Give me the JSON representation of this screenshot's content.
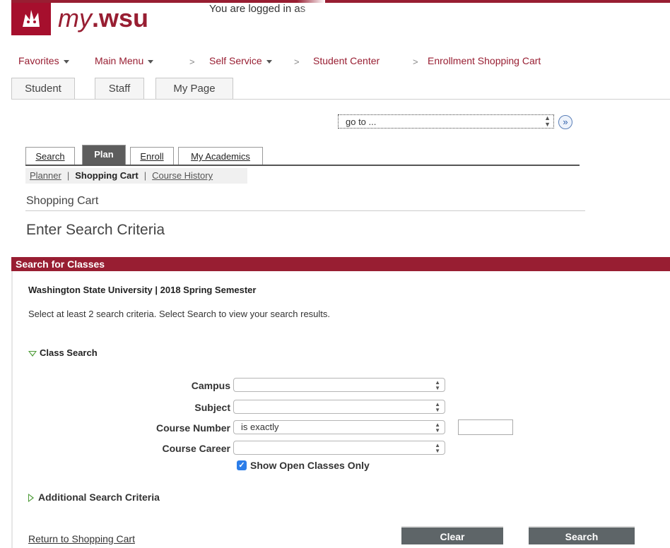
{
  "header": {
    "logo": {
      "my": "my",
      "wsu": ".wsu"
    },
    "login_text": "You are logged in as"
  },
  "nav": {
    "favorites": "Favorites",
    "main_menu": "Main Menu",
    "separator": ">",
    "self_service": "Self Service",
    "student_center": "Student Center",
    "enrollment_cart": "Enrollment Shopping Cart"
  },
  "top_tabs": [
    "Student",
    "Staff",
    "My Page"
  ],
  "goto": {
    "value": "go to ...",
    "go_glyph": "»"
  },
  "sub_tabs": {
    "search": "Search",
    "plan": "Plan",
    "enroll": "Enroll",
    "my_academics": "My Academics"
  },
  "sub_nav": {
    "planner": "Planner",
    "shopping_cart": "Shopping Cart",
    "course_history": "Course History",
    "divider": "|"
  },
  "shopping_cart_title": "Shopping Cart",
  "page_title": "Enter Search Criteria",
  "section": {
    "title": "Search for Classes",
    "institution_term": "Washington State University | 2018 Spring Semester",
    "hint": "Select at least 2 search criteria. Select Search to view your search results."
  },
  "class_search": {
    "heading": "Class Search",
    "campus_label": "Campus",
    "campus_value": "",
    "subject_label": "Subject",
    "subject_value": "",
    "course_number_label": "Course Number",
    "course_number_operator": "is exactly",
    "course_number_value": "",
    "course_career_label": "Course Career",
    "course_career_value": "",
    "open_only_label": "Show Open Classes Only",
    "open_only_checked": true
  },
  "additional_criteria": "Additional Search Criteria",
  "footer": {
    "return_link": "Return to Shopping Cart",
    "clear": "Clear",
    "search": "Search"
  },
  "colors": {
    "brand": "#981e32",
    "tab_active": "#5d5d5d",
    "button": "#5e6568"
  }
}
